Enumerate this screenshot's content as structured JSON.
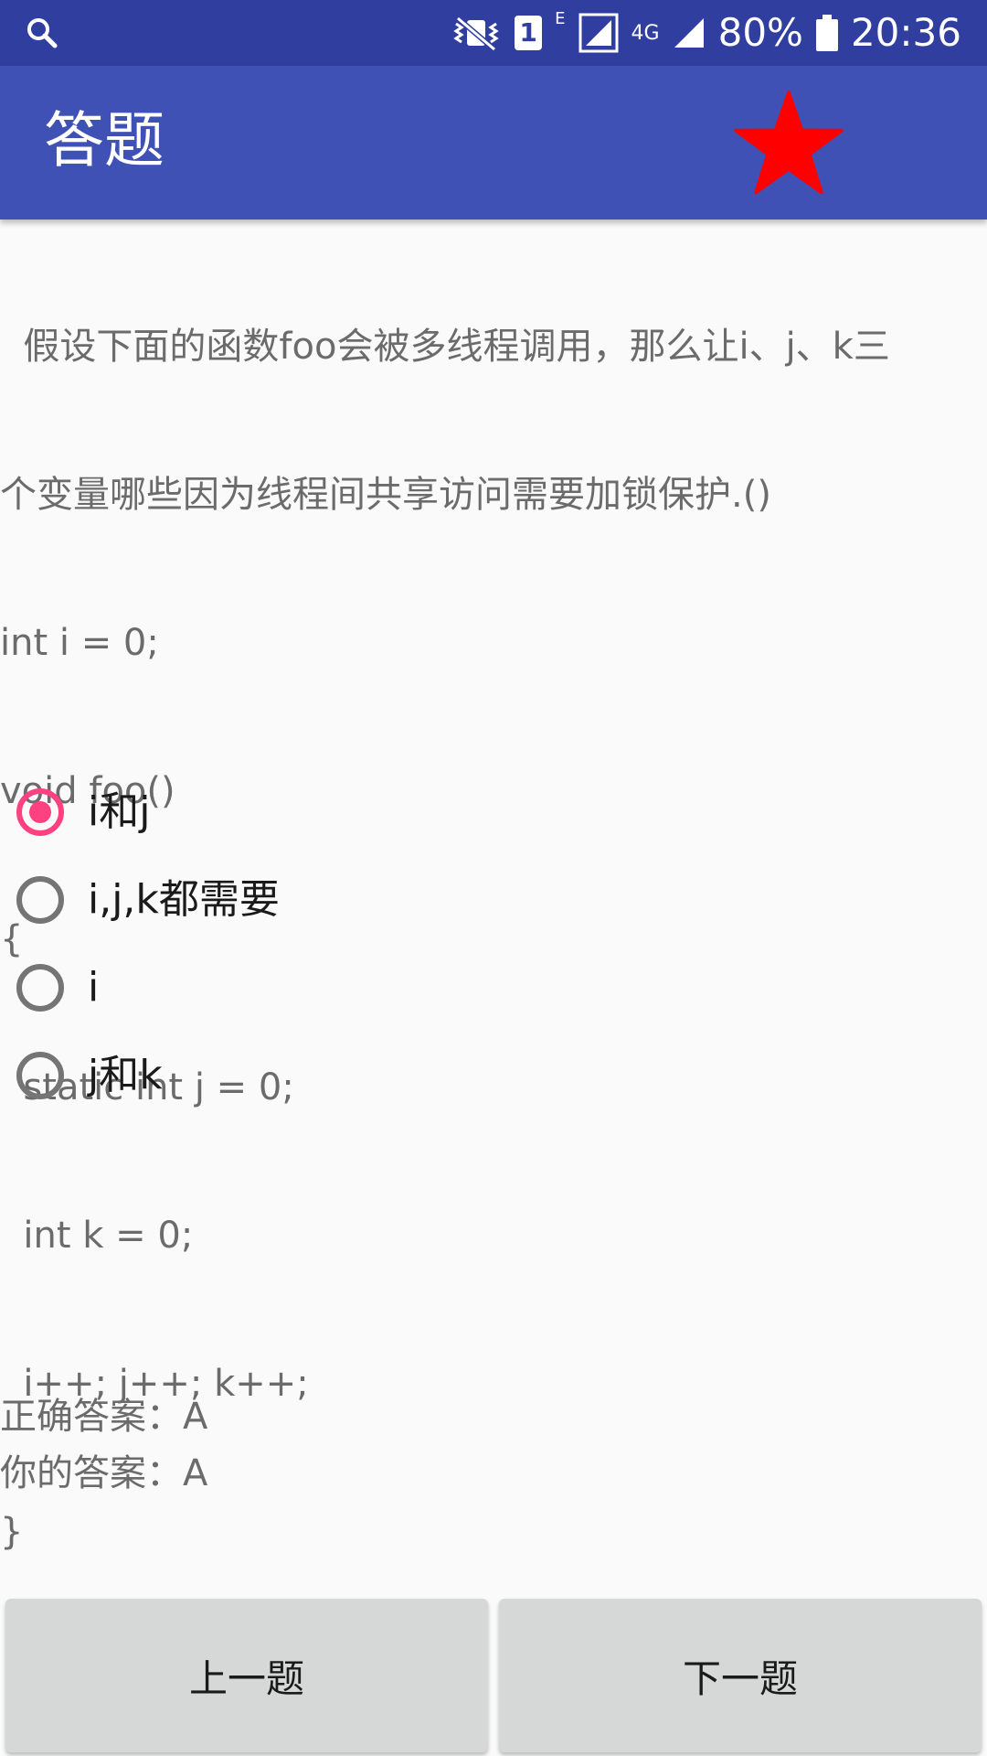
{
  "status_bar": {
    "battery_percent": "80%",
    "time": "20:36",
    "sim_slot": "1",
    "network_e": "E",
    "network_4g": "4G",
    "icons": [
      "search-icon",
      "mute-vibrate-icon",
      "sim-icon",
      "signal-icon",
      "signal-4g-icon",
      "battery-icon"
    ]
  },
  "app_bar": {
    "title": "答题",
    "favorite_icon": "star-icon",
    "favorite_color": "#ff0000"
  },
  "question": {
    "lines": [
      "  假设下面的函数foo会被多线程调用，那么让i、j、k三",
      "个变量哪些因为线程间共享访问需要加锁保护.()",
      "int i = 0;",
      "void foo()",
      "{",
      "  static int j = 0;",
      "  int k = 0;",
      "  i++; j++; k++;",
      "}"
    ]
  },
  "options": [
    {
      "label": "i和j",
      "checked": true
    },
    {
      "label": "i,j,k都需要",
      "checked": false
    },
    {
      "label": "i",
      "checked": false
    },
    {
      "label": "j和k",
      "checked": false
    }
  ],
  "answers": {
    "correct": "正确答案：A",
    "yours": "你的答案：A"
  },
  "buttons": {
    "prev_label": "上一题",
    "next_label": "下一题"
  },
  "colors": {
    "status_bar": "#303f9f",
    "app_bar": "#3f51b5",
    "accent": "#ff4081"
  }
}
